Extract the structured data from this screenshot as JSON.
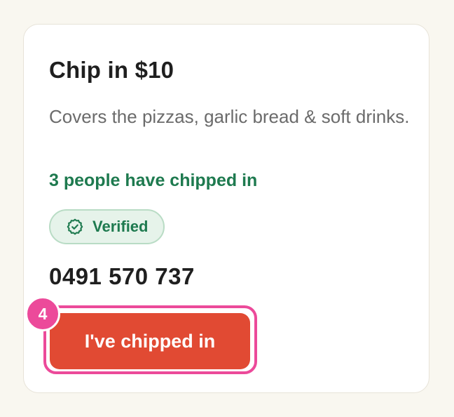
{
  "card": {
    "title": "Chip in $10",
    "description": "Covers the pizzas, garlic bread & soft drinks.",
    "contributors_text": "3 people have chipped in",
    "badge": {
      "icon": "check-badge-icon",
      "label": "Verified"
    },
    "phone": "0491 570 737",
    "cta_label": "I've chipped in",
    "step_number": "4"
  },
  "colors": {
    "page_background": "#f9f7f0",
    "card_background": "#ffffff",
    "accent_green": "#1e7a4f",
    "badge_background": "#e6f3ea",
    "cta_background": "#e14a33",
    "highlight_pink": "#ec4a9a"
  }
}
